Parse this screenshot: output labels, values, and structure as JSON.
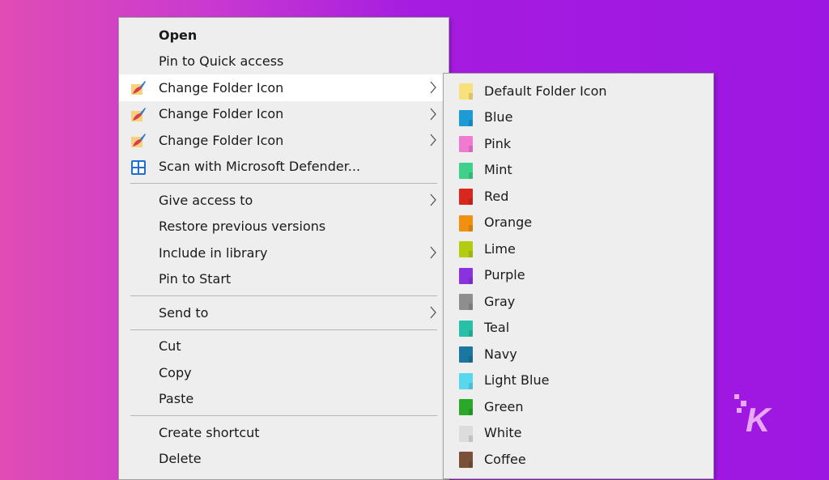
{
  "main_menu": {
    "items": [
      {
        "label": "Open",
        "bold": true
      },
      {
        "label": "Pin to Quick access"
      },
      {
        "label": "Change Folder Icon",
        "icon": "folder-paint-icon",
        "submenu": true,
        "highlighted": true
      },
      {
        "label": "Change Folder Icon",
        "icon": "folder-paint-icon",
        "submenu": true
      },
      {
        "label": "Change Folder Icon",
        "icon": "folder-paint-icon",
        "submenu": true
      },
      {
        "label": "Scan with Microsoft Defender...",
        "icon": "defender-shield-icon"
      },
      {
        "label": "Give access to",
        "submenu": true
      },
      {
        "label": "Restore previous versions"
      },
      {
        "label": "Include in library",
        "submenu": true
      },
      {
        "label": "Pin to Start"
      },
      {
        "label": "Send to",
        "submenu": true
      },
      {
        "label": "Cut"
      },
      {
        "label": "Copy"
      },
      {
        "label": "Paste"
      },
      {
        "label": "Create shortcut"
      },
      {
        "label": "Delete"
      }
    ]
  },
  "sub_menu": {
    "items": [
      {
        "label": "Default Folder Icon",
        "color": "#f8e07a"
      },
      {
        "label": "Blue",
        "color": "#1e9ad6"
      },
      {
        "label": "Pink",
        "color": "#f07ad0"
      },
      {
        "label": "Mint",
        "color": "#3fd08a"
      },
      {
        "label": "Red",
        "color": "#d8281e"
      },
      {
        "label": "Orange",
        "color": "#f0900e"
      },
      {
        "label": "Lime",
        "color": "#b4cc10"
      },
      {
        "label": "Purple",
        "color": "#8a32e0"
      },
      {
        "label": "Gray",
        "color": "#8e8e8e"
      },
      {
        "label": "Teal",
        "color": "#28c0a8"
      },
      {
        "label": "Navy",
        "color": "#1a78a0"
      },
      {
        "label": "Light Blue",
        "color": "#58d8ec"
      },
      {
        "label": "Green",
        "color": "#2aa82a"
      },
      {
        "label": "White",
        "color": "#dcdcdc"
      },
      {
        "label": "Coffee",
        "color": "#7a5038"
      }
    ]
  },
  "watermark": {
    "letter": "K"
  }
}
